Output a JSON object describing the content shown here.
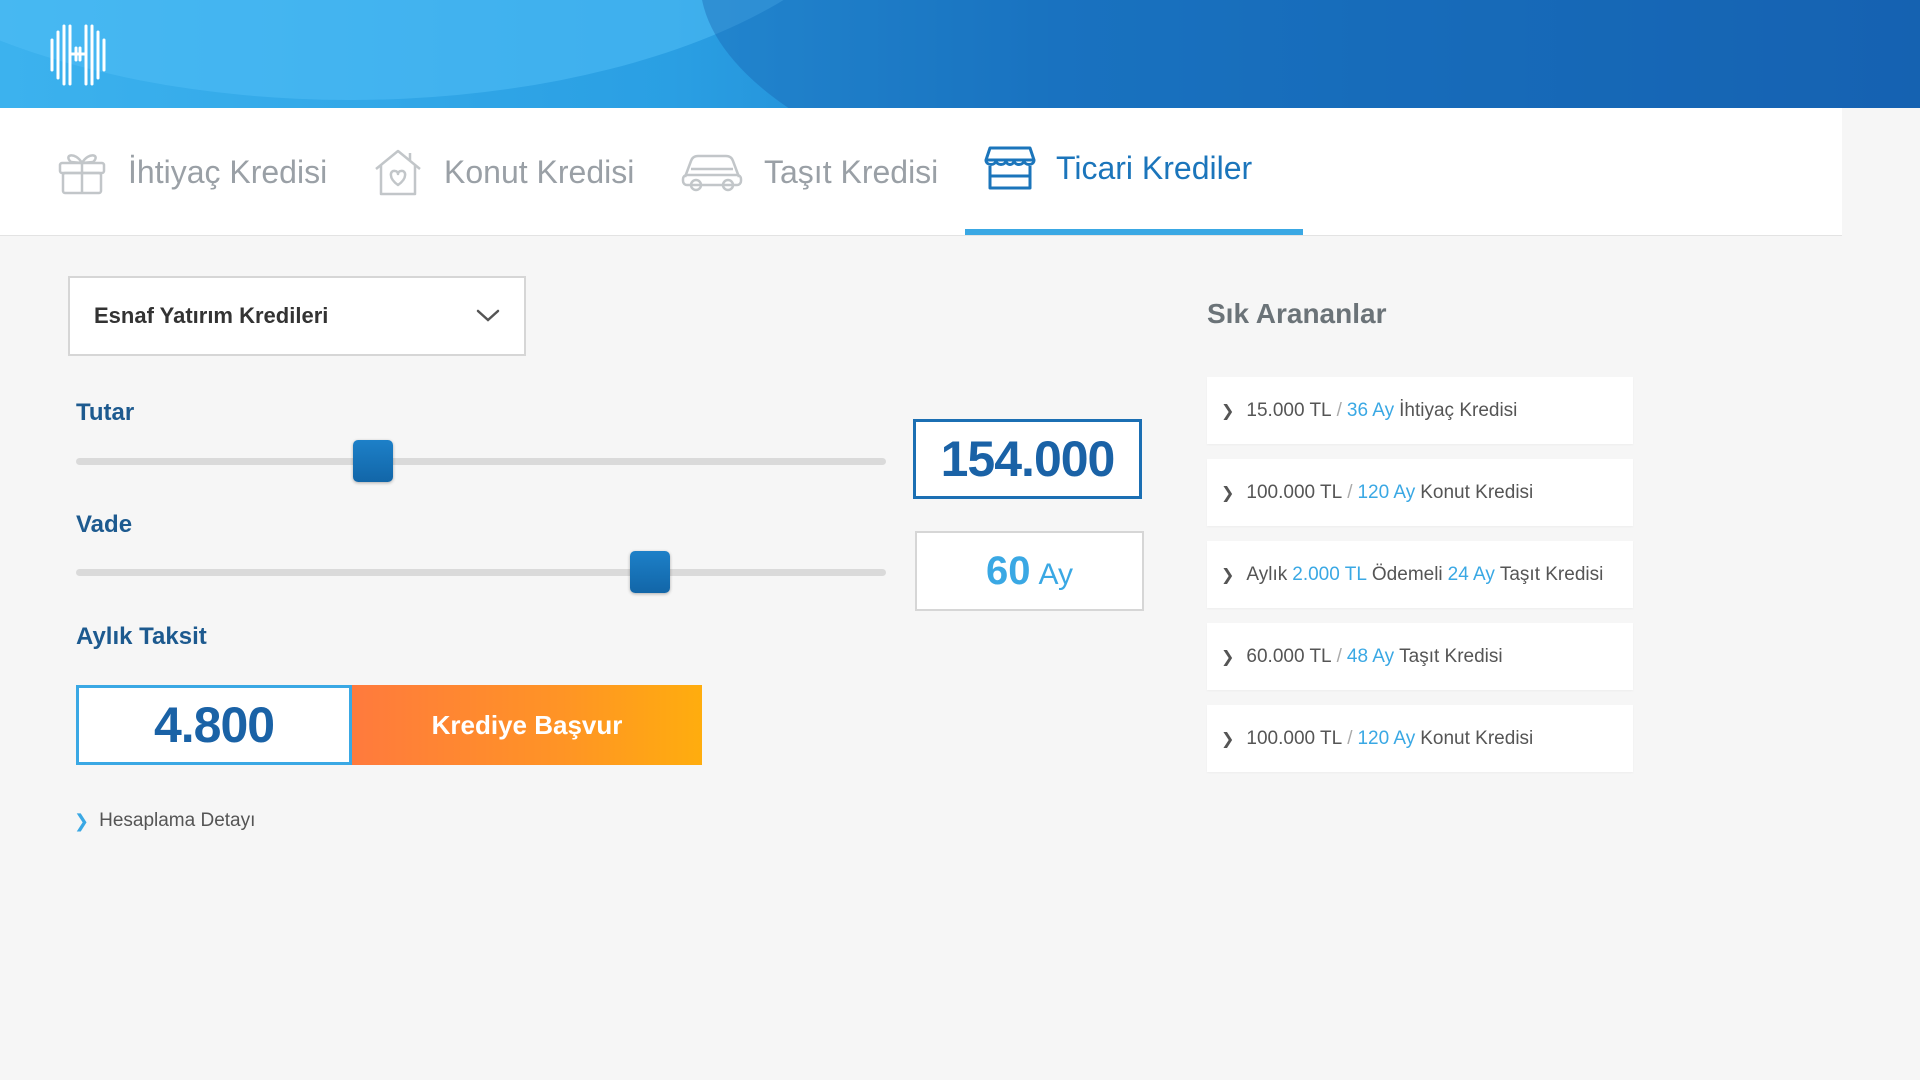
{
  "header": {
    "logo_icon": "halkbank-h-logo-icon"
  },
  "tabs": [
    {
      "label": "İhtiyaç Kredisi",
      "icon": "gift-icon",
      "active": false
    },
    {
      "label": "Konut Kredisi",
      "icon": "house-heart-icon",
      "active": false
    },
    {
      "label": "Taşıt Kredisi",
      "icon": "car-icon",
      "active": false
    },
    {
      "label": "Ticari Krediler",
      "icon": "storefront-icon",
      "active": true
    }
  ],
  "loan_type": {
    "selected": "Esnaf Yatırım Kredileri"
  },
  "amount": {
    "label": "Tutar",
    "value": "154.000",
    "slider_fraction": 0.36
  },
  "term": {
    "label": "Vade",
    "value": "60",
    "unit": "Ay",
    "slider_fraction": 0.72
  },
  "monthly": {
    "label": "Aylık Taksit",
    "value": "4.800",
    "apply_label": "Krediye Başvur"
  },
  "detail_link": "Hesaplama Detayı",
  "frequent": {
    "title": "Sık Arananlar",
    "items": [
      {
        "amount": "15.000 TL",
        "sep": "/",
        "term": "36 Ay",
        "type": "İhtiyaç Kredisi"
      },
      {
        "amount": "100.000 TL",
        "sep": "/",
        "term": "120 Ay",
        "type": "Konut Kredisi"
      },
      {
        "prefix": "Aylık",
        "amount": "2.000 TL",
        "middle": "Ödemeli",
        "term": "24 Ay",
        "type": "Taşıt Kredisi"
      },
      {
        "amount": "60.000 TL",
        "sep": "/",
        "term": "48 Ay",
        "type": "Taşıt Kredisi"
      },
      {
        "amount": "100.000 TL",
        "sep": "/",
        "term": "120 Ay",
        "type": "Konut Kredisi"
      }
    ]
  },
  "colors": {
    "primary": "#1b75bb",
    "accent": "#3aa8e4",
    "button_orange": "#ff9425"
  }
}
